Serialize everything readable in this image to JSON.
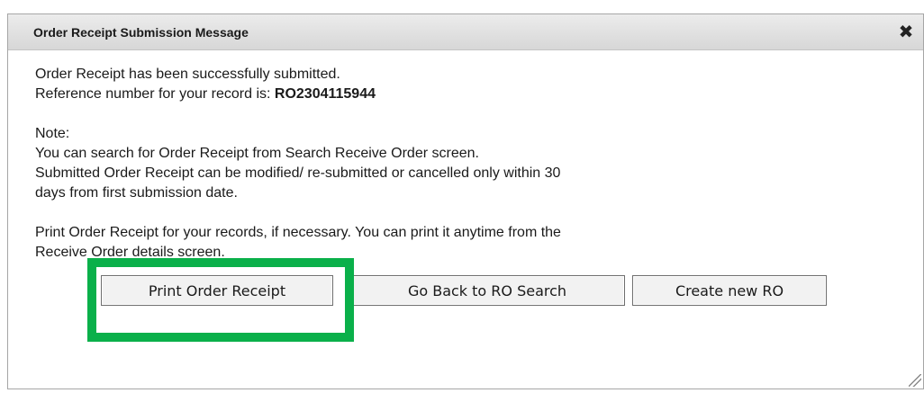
{
  "dialog": {
    "title": "Order Receipt Submission Message",
    "close_icon": "close-icon"
  },
  "message": {
    "line1": "Order Receipt has been successfully submitted.",
    "line2_prefix": "Reference number for your record is: ",
    "reference_number": "RO2304115944",
    "note_label": "Note:",
    "note_line1": "You can search for Order Receipt from Search Receive Order screen.",
    "note_line2": "Submitted Order Receipt can be modified/ re-submitted or cancelled only within 30",
    "note_line3": "days from first submission date.",
    "print_line1": "Print Order Receipt for your records, if necessary. You can print it anytime from the",
    "print_line2": "Receive Order details screen."
  },
  "buttons": {
    "print_label": "Print Order Receipt",
    "back_label": "Go Back to RO Search",
    "create_label": "Create new RO"
  },
  "colors": {
    "highlight": "#0ab04a",
    "titlebar": "#dcdcdc"
  }
}
